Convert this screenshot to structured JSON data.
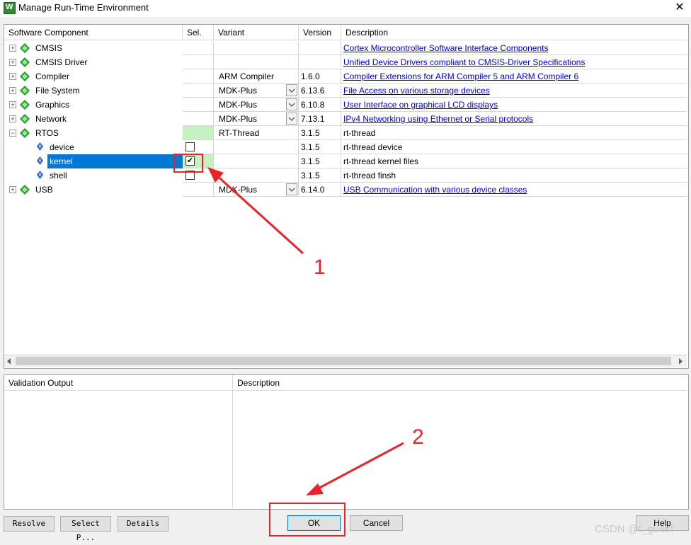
{
  "window": {
    "title": "Manage Run-Time Environment",
    "close_glyph": "✕",
    "app_icon": "app-logo-icon",
    "icon_letter": "W"
  },
  "tree": {
    "headers": {
      "component": "Software Component",
      "sel": "Sel.",
      "variant": "Variant",
      "version": "Version",
      "description": "Description"
    },
    "rows": [
      {
        "name": "CMSIS",
        "variant": "",
        "version": "",
        "description": "Cortex Microcontroller Software Interface Components",
        "link": true
      },
      {
        "name": "CMSIS Driver",
        "variant": "",
        "version": "",
        "description": "Unified Device Drivers compliant to CMSIS-Driver Specifications",
        "link": true
      },
      {
        "name": "Compiler",
        "variant": "ARM Compiler",
        "version": "1.6.0",
        "description": "Compiler Extensions for ARM Compiler 5 and ARM Compiler 6",
        "link": true
      },
      {
        "name": "File System",
        "variant": "MDK-Plus",
        "version": "6.13.6",
        "description": "File Access on various storage devices",
        "link": true
      },
      {
        "name": "Graphics",
        "variant": "MDK-Plus",
        "version": "6.10.8",
        "description": "User Interface on graphical LCD displays",
        "link": true
      },
      {
        "name": "Network",
        "variant": "MDK-Plus",
        "version": "7.13.1",
        "description": "IPv4 Networking using Ethernet or Serial protocols",
        "link": true
      },
      {
        "name": "RTOS",
        "variant": "RT-Thread",
        "version": "3.1.5",
        "description": "rt-thread",
        "link": false
      },
      {
        "name": "device",
        "variant": "",
        "version": "3.1.5",
        "description": "rt-thread device",
        "link": false
      },
      {
        "name": "kernel",
        "variant": "",
        "version": "3.1.5",
        "description": "rt-thread kernel files",
        "link": false
      },
      {
        "name": "shell",
        "variant": "",
        "version": "3.1.5",
        "description": "rt-thread finsh",
        "link": false
      },
      {
        "name": "USB",
        "variant": "MDK-Plus",
        "version": "6.14.0",
        "description": "USB Communication with various device classes",
        "link": true
      }
    ],
    "kernel_checked": true,
    "checkmark": "✔"
  },
  "validation": {
    "headers": {
      "output": "Validation Output",
      "description": "Description"
    }
  },
  "buttons": {
    "resolve": "Resolve",
    "select": "Select P...",
    "details": "Details",
    "ok": "OK",
    "cancel": "Cancel",
    "help": "Help"
  },
  "annotations": {
    "one": "1",
    "two": "2",
    "color": "#e8242a"
  },
  "watermark": "CSDN @t_guest",
  "colors": {
    "selection": "#0078d7",
    "green_cell": "#c6f0c2",
    "link": "#0000cc"
  }
}
